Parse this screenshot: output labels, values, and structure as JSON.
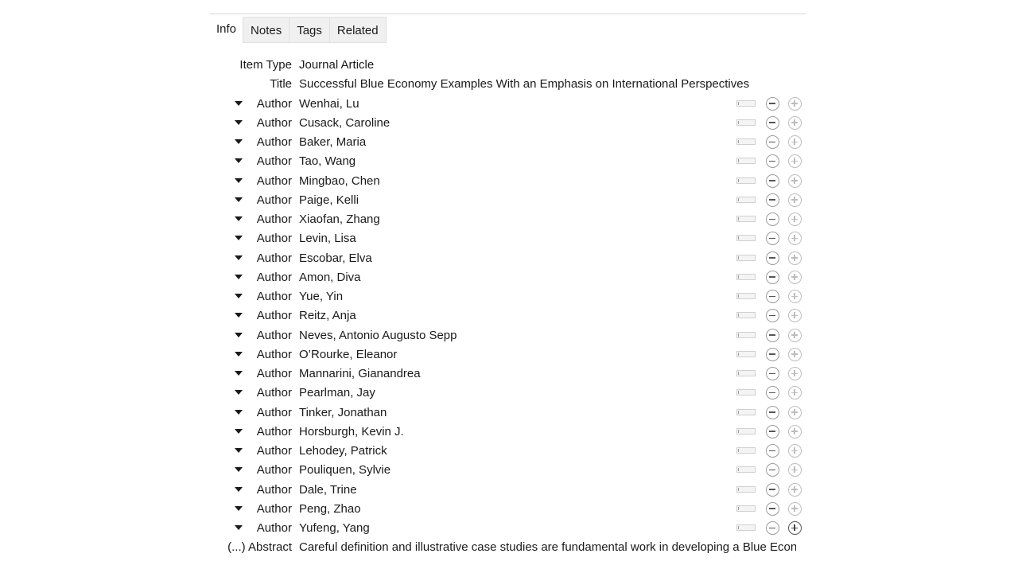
{
  "tabs": [
    {
      "label": "Info",
      "active": true
    },
    {
      "label": "Notes",
      "active": false
    },
    {
      "label": "Tags",
      "active": false
    },
    {
      "label": "Related",
      "active": false
    }
  ],
  "item_type": {
    "label": "Item Type",
    "value": "Journal Article"
  },
  "title": {
    "label": "Title",
    "value": "Successful Blue Economy Examples With an Emphasis on International Perspectives"
  },
  "author_label": "Author",
  "authors": [
    "Wenhai, Lu",
    "Cusack, Caroline",
    "Baker, Maria",
    "Tao, Wang",
    "Mingbao, Chen",
    "Paige, Kelli",
    "Xiaofan, Zhang",
    "Levin, Lisa",
    "Escobar, Elva",
    "Amon, Diva",
    "Yue, Yin",
    "Reitz, Anja",
    "Neves, Antonio Augusto Sepp",
    "O’Rourke, Eleanor",
    "Mannarini, Gianandrea",
    "Pearlman, Jay",
    "Tinker, Jonathan",
    "Horsburgh, Kevin J.",
    "Lehodey, Patrick",
    "Pouliquen, Sylvie",
    "Dale, Trine",
    "Peng, Zhao",
    "Yufeng, Yang"
  ],
  "abstract": {
    "label": "(...) Abstract",
    "value": "Careful definition and illustrative case studies are fundamental work in developing a Blue Econo..."
  },
  "icons": {
    "toggle": "triangle-down-icon",
    "mode": "name-mode-switch-icon",
    "remove": "minus-circle-icon",
    "add": "plus-circle-icon"
  }
}
